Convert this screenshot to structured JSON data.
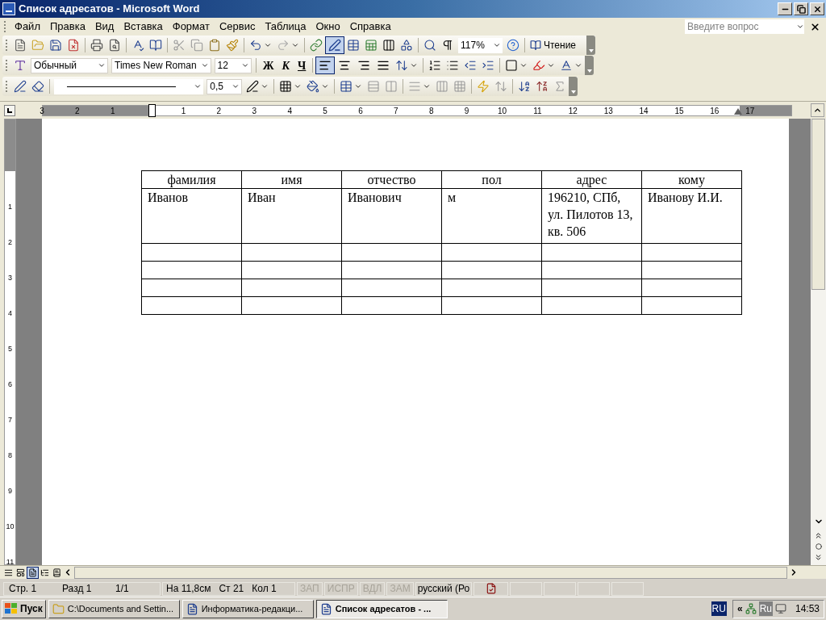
{
  "window": {
    "title": "Список адресатов - Microsoft Word"
  },
  "menu": [
    "Файл",
    "Правка",
    "Вид",
    "Вставка",
    "Формат",
    "Сервис",
    "Таблица",
    "Окно",
    "Справка"
  ],
  "help_search": {
    "placeholder": "Введите вопрос"
  },
  "toolbar_standard": {
    "tables_and_borders": {
      "selected": true
    },
    "zoom": "117%",
    "reading_button": "Чтение"
  },
  "toolbar_formatting": {
    "style": "Обычный",
    "font": "Times New Roman",
    "size": "12",
    "bold": "Ж",
    "italic": "К",
    "underline": "Ч",
    "alignment": [
      {
        "selected": true
      },
      {
        "selected": false
      },
      {
        "selected": false
      },
      {
        "selected": false
      }
    ]
  },
  "toolbar_tables": {
    "line_weight": "0,5"
  },
  "ruler": {
    "left_margin_labels": [
      "3",
      "2",
      "1"
    ],
    "labels": [
      "1",
      "2",
      "3",
      "4",
      "5",
      "6",
      "7",
      "8",
      "9",
      "10",
      "11",
      "12",
      "13",
      "14",
      "15",
      "16"
    ],
    "right_margin_labels": [
      "17"
    ],
    "vertical_labels": [
      "1",
      "2",
      "3",
      "4",
      "5",
      "6",
      "7",
      "8",
      "9",
      "10",
      "11"
    ]
  },
  "table": {
    "columns": [
      "фамилия",
      "имя",
      "отчество",
      "пол",
      "адрес",
      "кому"
    ],
    "rows": [
      {
        "cells": [
          "Иванов",
          "Иван",
          "Иванович",
          "м",
          "196210, СПб, ул. Пилотов 13, кв. 506",
          "Иванову И.И."
        ]
      },
      {},
      {},
      {},
      {}
    ]
  },
  "view_buttons": [
    {
      "selected": false
    },
    {
      "selected": false
    },
    {
      "selected": true
    },
    {
      "selected": false
    },
    {
      "selected": false
    }
  ],
  "status_bar": {
    "page": "Стр. 1",
    "section": "Разд 1",
    "pages": "1/1",
    "at": "На 11,8см",
    "line": "Ст 21",
    "column": "Кол 1",
    "modes": [
      {
        "label": "ЗАП",
        "on": false
      },
      {
        "label": "ИСПР",
        "on": false
      },
      {
        "label": "ВДЛ",
        "on": false
      },
      {
        "label": "ЗАМ",
        "on": false
      }
    ],
    "language": "русский (Ро"
  },
  "taskbar": {
    "start": "Пуск",
    "tasks": [
      {
        "label": "C:\\Documents and Settin...",
        "kind": "folder",
        "selected": false
      },
      {
        "label": "Информатика-редакци...",
        "kind": "word",
        "selected": false
      },
      {
        "label": "Список адресатов - ...",
        "kind": "word",
        "selected": true
      }
    ],
    "language": "RU",
    "tray_expand": "«",
    "tray_language": "Ru",
    "clock": "14:53"
  }
}
